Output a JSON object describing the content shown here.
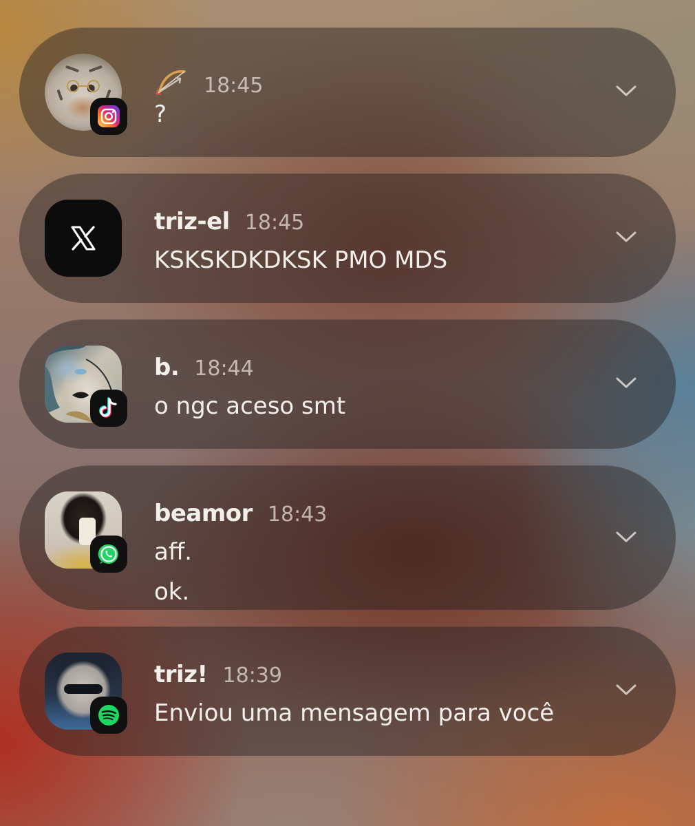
{
  "notifications": [
    {
      "sender": "",
      "sender_icon": "bow-and-arrow-icon",
      "time": "18:45",
      "messages": [
        "?"
      ],
      "app": "instagram",
      "app_icon": "instagram-icon"
    },
    {
      "sender": "triz-el",
      "time": "18:45",
      "messages": [
        "KSKSKDKDKSK PMO MDS"
      ],
      "app": "x",
      "app_icon": "x-logo-icon"
    },
    {
      "sender": "b.",
      "time": "18:44",
      "messages": [
        "o ngc aceso smt"
      ],
      "app": "tiktok",
      "app_icon": "tiktok-icon"
    },
    {
      "sender": "beamor",
      "time": "18:43",
      "messages": [
        "aff.",
        "ok."
      ],
      "app": "whatsapp",
      "app_icon": "whatsapp-icon"
    },
    {
      "sender": "triz!",
      "time": "18:39",
      "messages": [
        "Enviou uma mensagem para você"
      ],
      "app": "spotify",
      "app_icon": "spotify-icon"
    }
  ],
  "colors": {
    "instagram_gradient": [
      "#feda75",
      "#fa7e1e",
      "#d62976",
      "#962fbf",
      "#4f5bd5"
    ],
    "whatsapp": "#25d366",
    "spotify": "#1ed760",
    "tiktok_cyan": "#25f4ee",
    "tiktok_red": "#fe2c55"
  }
}
